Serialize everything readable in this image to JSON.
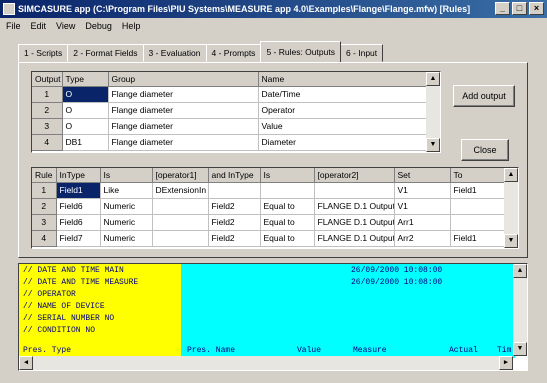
{
  "window": {
    "title": "SIMCASURE app (C:\\Program Files\\PIU Systems\\MEASURE app 4.0\\Examples\\Flange\\Flange.mfw) [Rules]",
    "buttons": [
      "_",
      "□",
      "×"
    ]
  },
  "menu": [
    "File",
    "Edit",
    "View",
    "Debug",
    "Help"
  ],
  "tabs": [
    "1 - Scripts",
    "2 - Format Fields",
    "3 - Evaluation",
    "4 - Prompts",
    "5 - Rules: Outputs",
    "6 - Input"
  ],
  "active_tab": 4,
  "outputs_table": {
    "columns": [
      "Output",
      "Type",
      "Group",
      "Name"
    ],
    "rows": [
      {
        "num": "1",
        "type": "O",
        "group": "Flange diameter",
        "name": "Date/Time"
      },
      {
        "num": "2",
        "type": "O",
        "group": "Flange diameter",
        "name": "Operator"
      },
      {
        "num": "3",
        "type": "O",
        "group": "Flange diameter",
        "name": "Value"
      },
      {
        "num": "4",
        "type": "DB1",
        "group": "Flange diameter",
        "name": "Diameter"
      }
    ]
  },
  "rules_table": {
    "columns": [
      "Rule",
      "InType",
      "Is",
      "[operator1]",
      "and InType",
      "Is",
      "[operator2]",
      "Set",
      "To"
    ],
    "rows": [
      {
        "num": "1",
        "c1": "Field1",
        "c2": "Like",
        "c3": "DExtensionIn",
        "c4": "",
        "c5": "",
        "c6": "",
        "c7": "V1",
        "c8": "Field1"
      },
      {
        "num": "2",
        "c1": "Field6",
        "c2": "Numeric",
        "c3": "",
        "c4": "Field2",
        "c5": "Equal to",
        "c6": "FLANGE D.1 Output1",
        "c7": "V1",
        "c8": ""
      },
      {
        "num": "3",
        "c1": "Field6",
        "c2": "Numeric",
        "c3": "",
        "c4": "Field2",
        "c5": "Equal to",
        "c6": "FLANGE D.1 Output2",
        "c7": "Arr1",
        "c8": ""
      },
      {
        "num": "4",
        "c1": "Field7",
        "c2": "Numeric",
        "c3": "",
        "c4": "Field2",
        "c5": "Equal to",
        "c6": "FLANGE D.1 Output3",
        "c7": "Arr2",
        "c8": "Field1"
      }
    ]
  },
  "buttons": {
    "add_output": "Add output",
    "close": "Close"
  },
  "console": {
    "left_lines": [
      "// DATE AND TIME MAIN",
      "// DATE AND TIME MEASURE",
      "// OPERATOR",
      "// NAME OF DEVICE",
      "// SERIAL NUMBER NO",
      "// CONDITION NO",
      "Pres. Type"
    ],
    "right_lines": [
      "26/09/2000 10:08:00",
      "26/09/2000 10:08:00"
    ],
    "footer": {
      "c1": "Pres. Name",
      "c2": "Value",
      "c3": "Measure",
      "c4": "Actual",
      "c5": "Tim"
    }
  }
}
